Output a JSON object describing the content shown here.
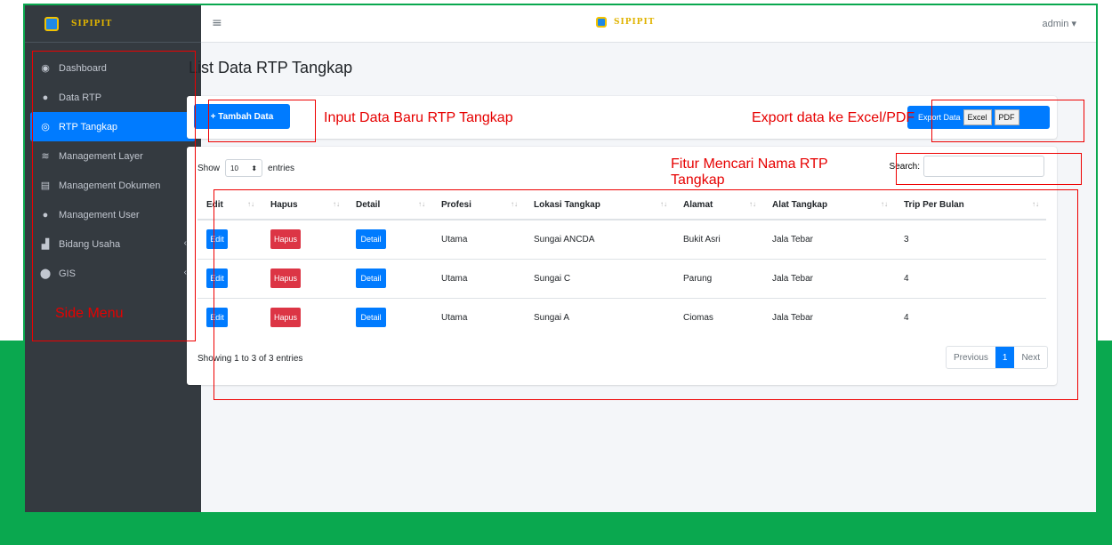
{
  "brand": {
    "name": "SIPIPIT"
  },
  "sidebar": {
    "items": [
      {
        "label": "Dashboard",
        "icon": "dashboard-icon",
        "glyph": "◉"
      },
      {
        "label": "Data RTP",
        "icon": "user-icon",
        "glyph": "●"
      },
      {
        "label": "RTP Tangkap",
        "icon": "globe-icon",
        "glyph": "◎",
        "active": true
      },
      {
        "label": "Management Layer",
        "icon": "layers-icon",
        "glyph": "≋"
      },
      {
        "label": "Management Dokumen",
        "icon": "document-icon",
        "glyph": "▤"
      },
      {
        "label": "Management User",
        "icon": "user-icon",
        "glyph": "●"
      },
      {
        "label": "Bidang Usaha",
        "icon": "chart-icon",
        "glyph": "▟",
        "chevron": "‹"
      },
      {
        "label": "GIS",
        "icon": "map-marker-icon",
        "glyph": "⬤",
        "chevron": "‹"
      }
    ]
  },
  "topnav": {
    "hamburger": "≡",
    "user": "admin ▾"
  },
  "page": {
    "title": "List Data RTP Tangkap"
  },
  "toolbar": {
    "add_label": "+ Tambah Data",
    "export_label": "Export Data",
    "excel_label": "Excel",
    "pdf_label": "PDF"
  },
  "table_controls": {
    "show_label": "Show",
    "show_value": "10",
    "entries_label": "entries",
    "search_label": "Search:"
  },
  "table": {
    "columns": [
      "Edit",
      "Hapus",
      "Detail",
      "Profesi",
      "Lokasi Tangkap",
      "Alamat",
      "Alat Tangkap",
      "Trip Per Bulan"
    ],
    "rows": [
      {
        "edit": "Edit",
        "hapus": "Hapus",
        "detail": "Detail",
        "profesi": "Utama",
        "lokasi": "Sungai ANCDA",
        "alamat": "Bukit Asri",
        "alat": "Jala Tebar",
        "trip": "3"
      },
      {
        "edit": "Edit",
        "hapus": "Hapus",
        "detail": "Detail",
        "profesi": "Utama",
        "lokasi": "Sungai C",
        "alamat": "Parung",
        "alat": "Jala Tebar",
        "trip": "4"
      },
      {
        "edit": "Edit",
        "hapus": "Hapus",
        "detail": "Detail",
        "profesi": "Utama",
        "lokasi": "Sungai A",
        "alamat": "Ciomas",
        "alat": "Jala Tebar",
        "trip": "4"
      }
    ]
  },
  "footer": {
    "showing": "Showing 1 to 3 of 3 entries",
    "prev": "Previous",
    "page": "1",
    "next": "Next"
  },
  "annotations": {
    "side_menu": "Side Menu",
    "input_data": "Input Data Baru RTP Tangkap",
    "export": "Export data ke Excel/PDF",
    "search_line1": "Fitur Mencari Nama RTP",
    "search_line2": "Tangkap"
  },
  "colors": {
    "accent": "#007bff",
    "danger": "#dc3545",
    "sidebar": "#343a40",
    "annotation": "#e60000",
    "frame_green": "#0aa84f"
  }
}
